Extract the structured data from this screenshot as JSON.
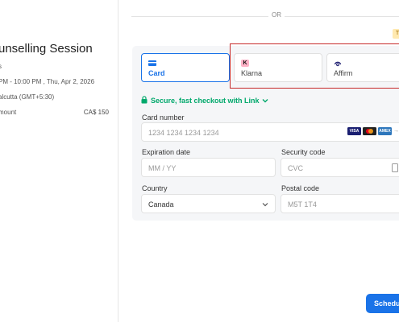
{
  "session": {
    "title": "unselling Session",
    "line1": "s",
    "time": "PM - 10:00 PM , Thu, Apr 2, 2026",
    "timezone": "alcutta (GMT+5:30)",
    "amount_label": "mount",
    "amount_value": "CA$ 150"
  },
  "divider": {
    "or_text": "OR"
  },
  "test_badge": "T",
  "tabs": [
    {
      "label": "Card",
      "icon": "card-icon",
      "selected": true
    },
    {
      "label": "Klarna",
      "icon": "klarna-logo",
      "logo_text": "K"
    },
    {
      "label": "Affirm",
      "icon": "affirm-logo"
    }
  ],
  "link": {
    "text": "Secure, fast checkout with Link"
  },
  "card_number": {
    "label": "Card number",
    "placeholder": "1234 1234 1234 1234"
  },
  "brands": {
    "visa": "VISA",
    "amex": "AMEX",
    "more": "→"
  },
  "expiration": {
    "label": "Expiration date",
    "placeholder": "MM / YY"
  },
  "security": {
    "label": "Security code",
    "placeholder": "CVC"
  },
  "country": {
    "label": "Country",
    "value": "Canada"
  },
  "postal": {
    "label": "Postal code",
    "placeholder": "M5T 1T4"
  },
  "schedule_button": {
    "label": "Schedule"
  },
  "colors": {
    "accent": "#1a73e8",
    "link_green": "#00a86b",
    "highlight": "#c62828"
  }
}
